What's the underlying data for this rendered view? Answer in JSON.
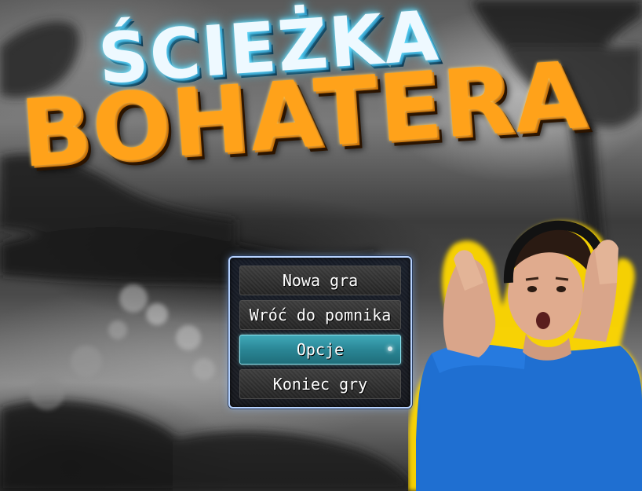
{
  "title": {
    "line1": "ŚCIEŻKA",
    "line2": "BOHATERA"
  },
  "menu": {
    "items": [
      {
        "label": "Nowa gra",
        "selected": false
      },
      {
        "label": "Wróć do pomnika",
        "selected": false
      },
      {
        "label": "Opcje",
        "selected": true
      },
      {
        "label": "Koniec gry",
        "selected": false
      }
    ]
  },
  "colors": {
    "title_top": "#eef9ff",
    "title_top_glow": "#43d4ff",
    "title_bottom": "#ffa21a",
    "menu_border": "#b7d3ff",
    "menu_selected": "#2a8695",
    "person_outline": "#ffd800",
    "shirt": "#1f6fd1"
  },
  "icons": {
    "headphones": "headphones-icon"
  }
}
